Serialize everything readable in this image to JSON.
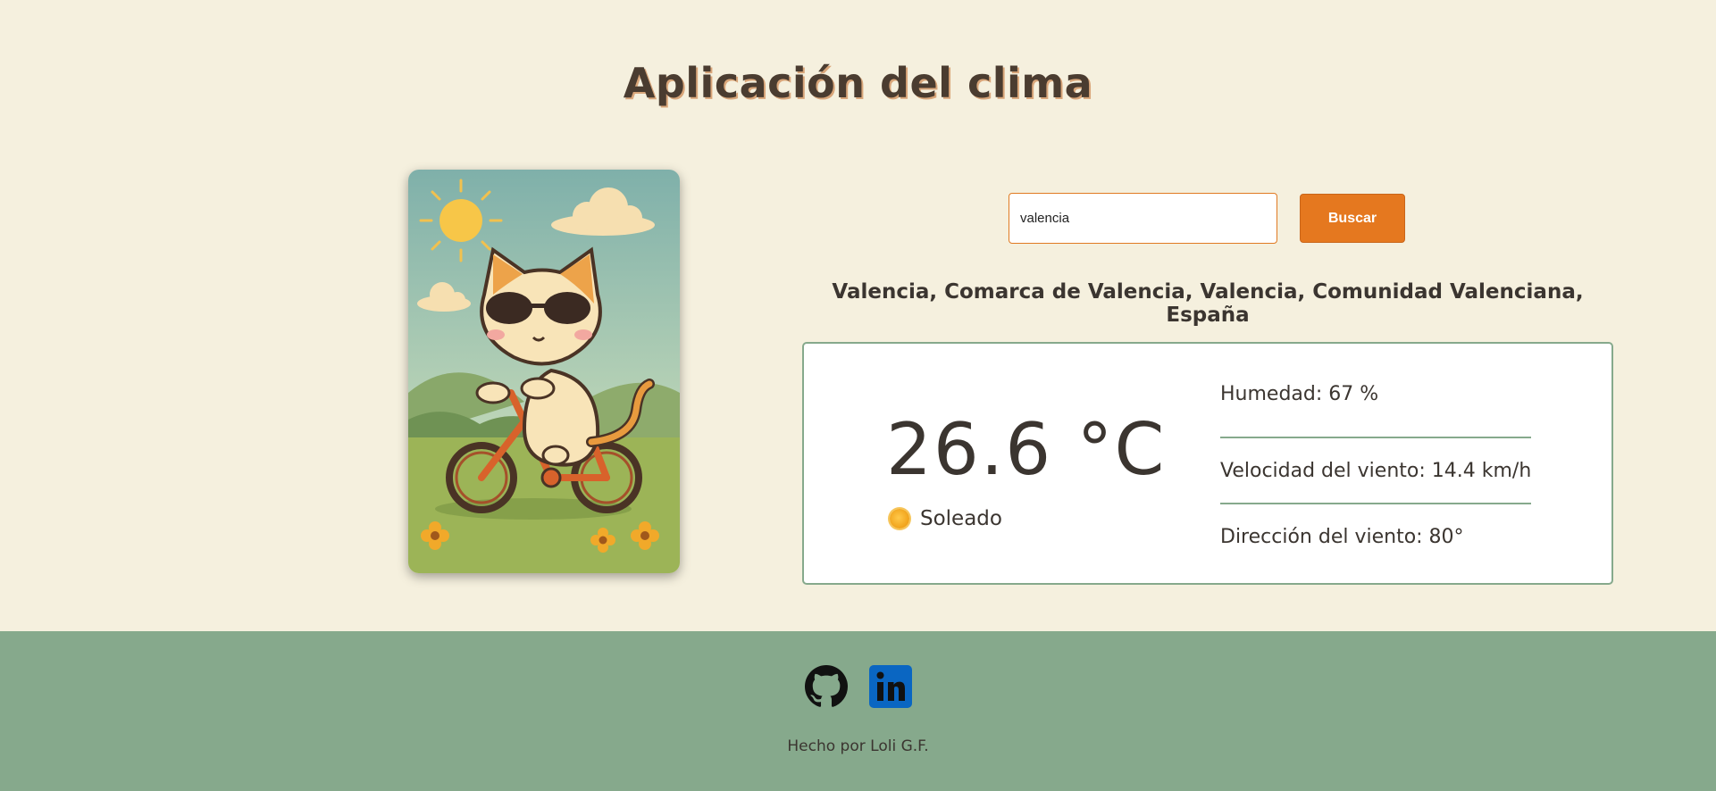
{
  "header": {
    "title": "Aplicación del clima"
  },
  "search": {
    "value": "valencia",
    "button_label": "Buscar"
  },
  "location": {
    "name": "Valencia, Comarca de Valencia, Valencia, Comunidad Valenciana, España"
  },
  "weather": {
    "temperature": "26.6 °C",
    "condition": "Soleado",
    "condition_icon": "sun-icon",
    "details": [
      {
        "label": "Humedad: 67 %"
      },
      {
        "label": "Velocidad del viento: 14.4 km/h"
      },
      {
        "label": "Dirección del viento: 80°"
      }
    ]
  },
  "illustration": {
    "subject": "cat-on-bicycle-illustration"
  },
  "footer": {
    "links": [
      {
        "icon": "github-icon"
      },
      {
        "icon": "linkedin-icon"
      }
    ],
    "credit": "Hecho por Loli G.F."
  },
  "colors": {
    "background": "#f5f0de",
    "accent": "#e5781f",
    "footer": "#86a98c",
    "card_border": "#86a98c",
    "text": "#3b3530"
  }
}
